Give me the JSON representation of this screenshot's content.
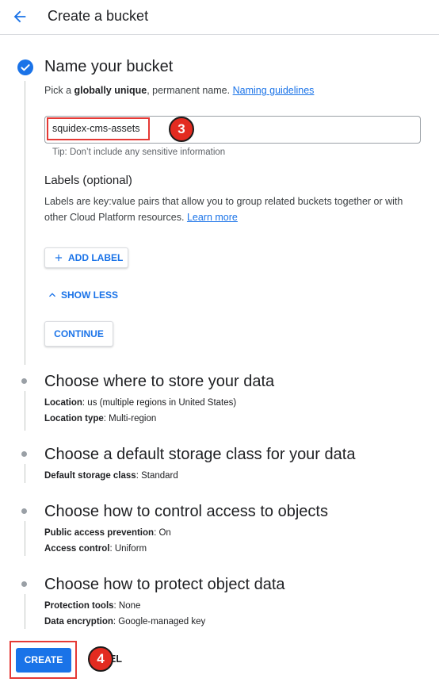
{
  "header": {
    "title": "Create a bucket"
  },
  "step1": {
    "title": "Name your bucket",
    "desc_prefix": "Pick a ",
    "desc_bold": "globally unique",
    "desc_suffix": ", permanent name. ",
    "desc_link": "Naming guidelines",
    "bucket_name": "squidex-cms-assets",
    "tip": "Tip: Don’t include any sensitive information",
    "labels_title": "Labels (optional)",
    "labels_desc": "Labels are key:value pairs that allow you to group related buckets together or with other Cloud Platform resources. ",
    "labels_link": "Learn more",
    "add_label": "ADD LABEL",
    "show_less": "SHOW LESS",
    "continue": "CONTINUE"
  },
  "step2": {
    "title": "Choose where to store your data",
    "location_label": "Location",
    "location_value": ": us (multiple regions in United States)",
    "type_label": "Location type",
    "type_value": ": Multi-region"
  },
  "step3": {
    "title": "Choose a default storage class for your data",
    "class_label": "Default storage class",
    "class_value": ": Standard"
  },
  "step4": {
    "title": "Choose how to control access to objects",
    "pap_label": "Public access prevention",
    "pap_value": ": On",
    "ac_label": "Access control",
    "ac_value": ": Uniform"
  },
  "step5": {
    "title": "Choose how to protect object data",
    "pt_label": "Protection tools",
    "pt_value": ": None",
    "enc_label": "Data encryption",
    "enc_value": ": Google-managed key"
  },
  "footer": {
    "create": "CREATE",
    "cancel_visible": "EL"
  },
  "annotations": {
    "badge_name": "3",
    "badge_create": "4"
  },
  "colors": {
    "accent": "#1a73e8",
    "annotation_red": "#e32b20",
    "text": "#202124"
  },
  "icons": [
    "arrow-back-icon",
    "check-circle-icon",
    "plus-icon",
    "chevron-up-icon"
  ]
}
